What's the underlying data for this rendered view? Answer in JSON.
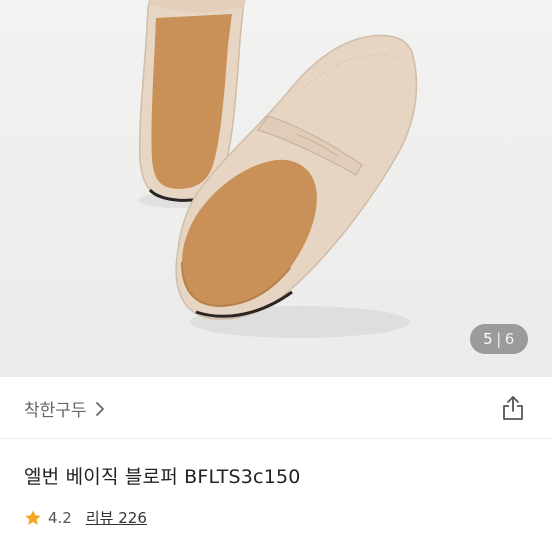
{
  "gallery": {
    "current": "5",
    "separator": "|",
    "total": "6"
  },
  "brand": {
    "name": "착한구두"
  },
  "product": {
    "title": "엘번 베이직 블로퍼 BFLTS3c150",
    "rating": "4.2",
    "review_label": "리뷰",
    "review_count": "226"
  },
  "colors": {
    "star": "#f5a623",
    "shoe_upper": "#e6d3c0",
    "insole": "#c98f59"
  },
  "icons": {
    "brand_chevron": "chevron-right-icon",
    "share": "share-icon",
    "rating": "star-icon"
  }
}
